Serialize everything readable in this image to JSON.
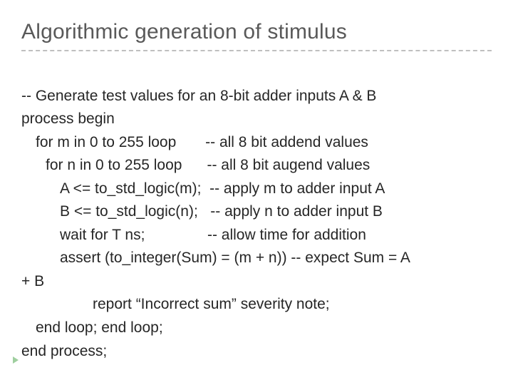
{
  "title": "Algorithmic generation of stimulus",
  "code": {
    "l1": "-- Generate test values for an 8-bit adder inputs A & B",
    "l2": "process begin",
    "l3": "for m in 0 to 255 loop       -- all 8 bit addend values",
    "l4": "for n in 0 to 255 loop      -- all 8 bit augend values",
    "l5": "A <= to_std_logic(m);  -- apply m to adder input A",
    "l6": "B <= to_std_logic(n);   -- apply n to adder input B",
    "l7": "wait for T ns;               -- allow time for addition",
    "l8": "assert (to_integer(Sum) = (m + n)) -- expect Sum = A",
    "l8b": "+ B",
    "l9": "report “Incorrect sum” severity note;",
    "l10": "end loop; end loop;",
    "l11": "end process;"
  }
}
